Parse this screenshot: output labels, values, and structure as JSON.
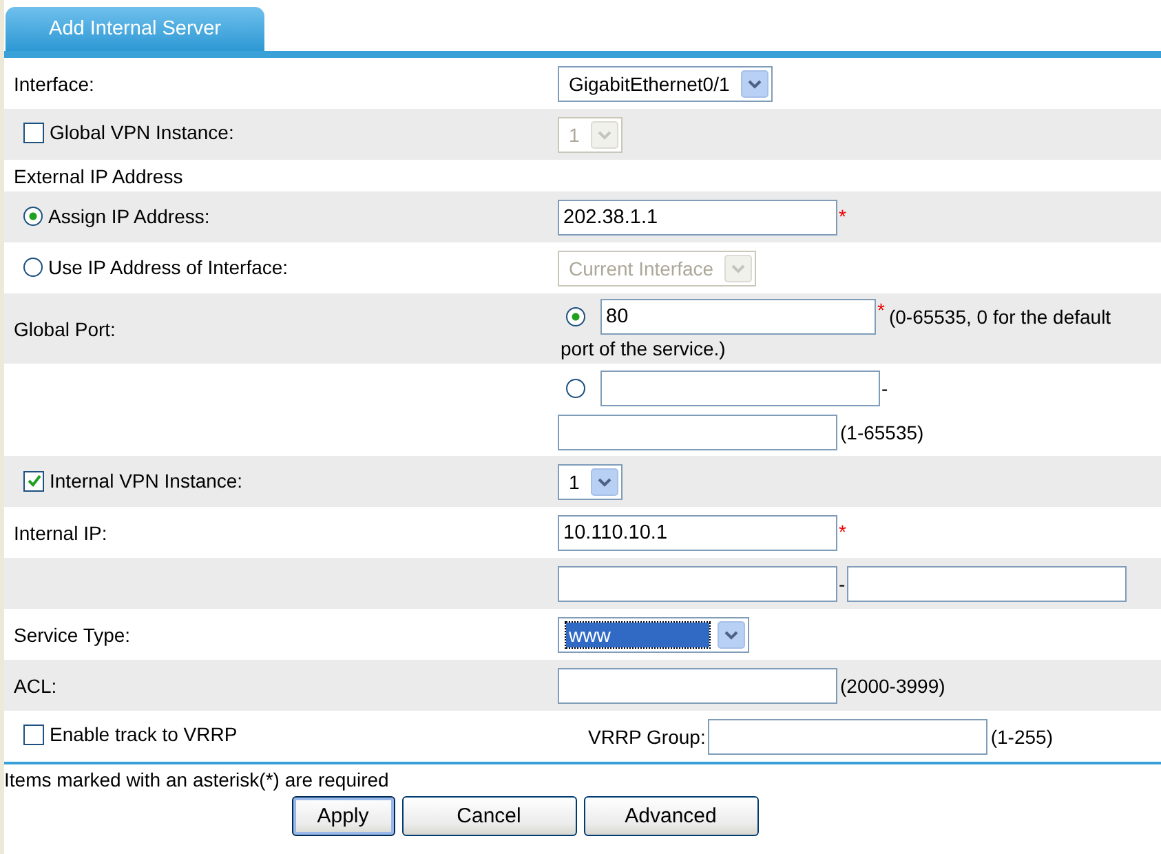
{
  "tabs": [
    {
      "label": "Add Internal Server",
      "selected": true
    }
  ],
  "rows": [
    {
      "kind": "select",
      "label": "Interface:",
      "value": "GigabitEthernet0/1",
      "disabled": false,
      "focused": false
    },
    {
      "kind": "check-select",
      "label": "Global VPN Instance:",
      "checked": false,
      "value": "1",
      "disabled": true
    },
    {
      "kind": "heading",
      "label": "External IP Address"
    },
    {
      "kind": "radio-input",
      "label": "Assign IP Address:",
      "selected": true,
      "value": "202.38.1.1",
      "required_mark": "*"
    },
    {
      "kind": "radio-select",
      "label": "Use IP Address of Interface:",
      "selected": false,
      "value": "Current Interface",
      "disabled": true
    },
    {
      "kind": "port",
      "label": "Global Port:",
      "selected": true,
      "value": "80",
      "required_mark": "*",
      "hint": "(0-65535, 0 for the default",
      "hint_continued": "port of the service.)"
    },
    {
      "kind": "port-range",
      "selected": false,
      "separator": "-",
      "hint": "(1-65535)"
    },
    {
      "kind": "check-select",
      "label": "Internal VPN Instance:",
      "checked": true,
      "value": "1",
      "disabled": false
    },
    {
      "kind": "input",
      "label": "Internal IP:",
      "value": "10.110.10.1",
      "required_mark": "*"
    },
    {
      "kind": "range",
      "separator": "-"
    },
    {
      "kind": "select",
      "label": "Service Type:",
      "value": "www",
      "disabled": false,
      "focused": true
    },
    {
      "kind": "input",
      "label": "ACL:",
      "hint": "(2000-3999)"
    },
    {
      "kind": "vrrp",
      "label": "Enable track to VRRP",
      "checked": false,
      "field_label": "VRRP Group:",
      "hint": "(1-255)"
    }
  ],
  "note": "Items marked with an asterisk(*) are required",
  "buttons": [
    {
      "label": "Apply",
      "default": true
    },
    {
      "label": "Cancel",
      "default": false
    },
    {
      "label": "Advanced",
      "default": false
    }
  ]
}
